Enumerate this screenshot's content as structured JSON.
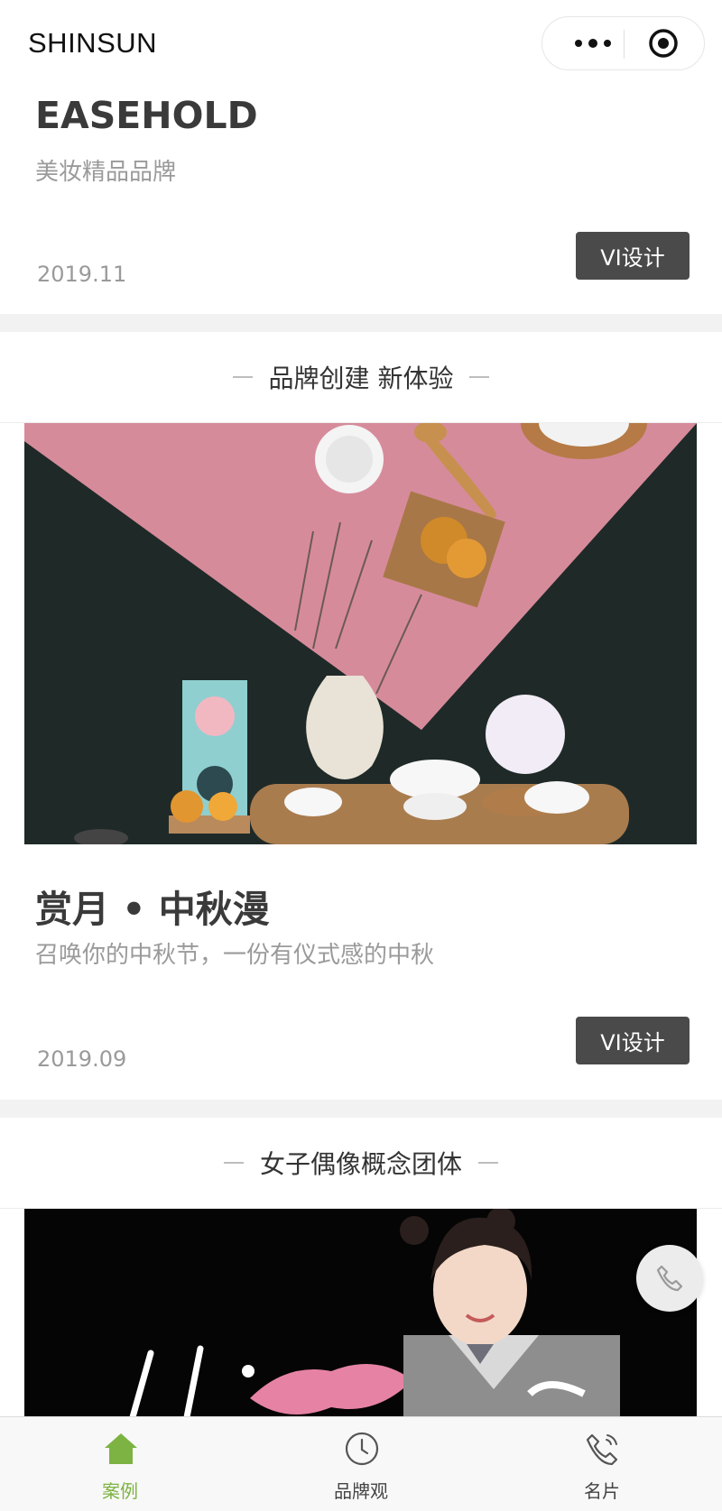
{
  "header": {
    "title": "SHINSUN"
  },
  "cards": [
    {
      "title": "EASEHOLD",
      "subtitle": "美妆精品品牌",
      "date": "2019.11",
      "tag": "VI设计"
    },
    {
      "section": "品牌创建 新体验",
      "title": "赏月 • 中秋漫",
      "subtitle": "召唤你的中秋节，一份有仪式感的中秋",
      "date": "2019.09",
      "tag": "VI设计"
    },
    {
      "section": "女子偶像概念团体"
    }
  ],
  "tabbar": {
    "items": [
      {
        "label": "案例",
        "icon": "home-icon",
        "active": true
      },
      {
        "label": "品牌观",
        "icon": "clock-icon",
        "active": false
      },
      {
        "label": "名片",
        "icon": "phone-icon",
        "active": false
      }
    ]
  },
  "colors": {
    "accent": "#7cb342",
    "tag_bg": "#4a4a4a",
    "gap": "#f2f2f2"
  }
}
